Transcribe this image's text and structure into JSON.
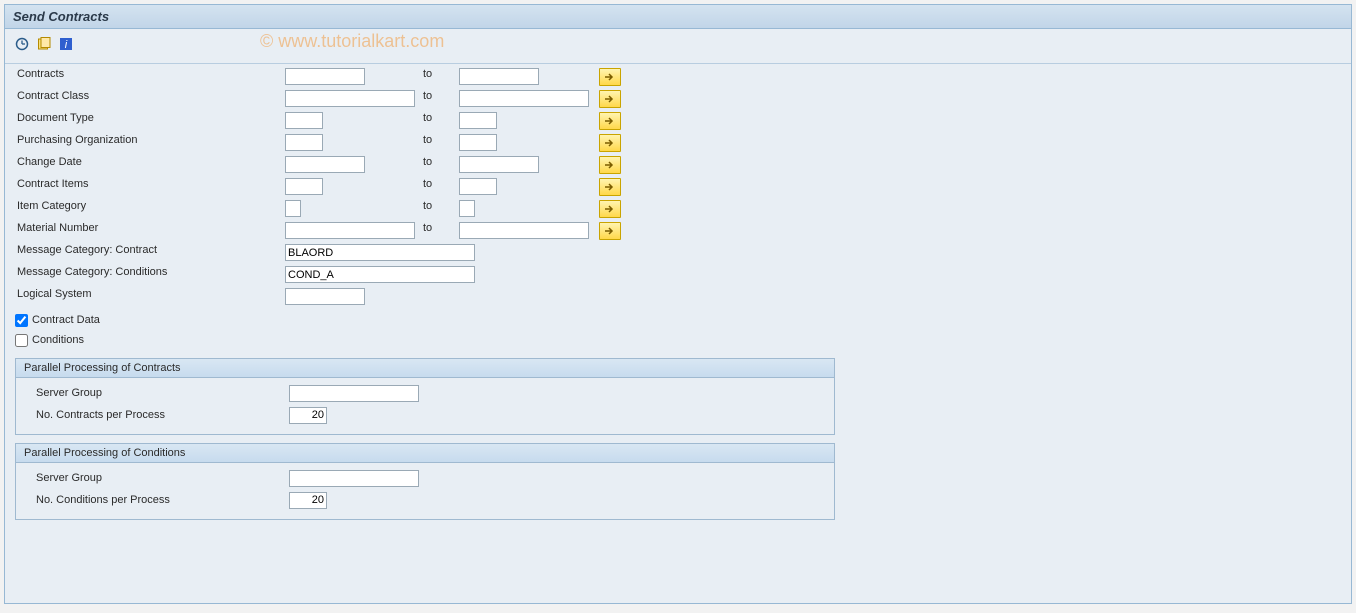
{
  "window": {
    "title": "Send Contracts"
  },
  "watermark": "© www.tutorialkart.com",
  "toolbar": {
    "execute": "execute",
    "variant": "get-variant",
    "info": "info"
  },
  "fields": {
    "contracts": {
      "label": "Contracts",
      "low": "",
      "to": "to",
      "high": ""
    },
    "contract_class": {
      "label": "Contract Class",
      "low": "",
      "to": "to",
      "high": ""
    },
    "document_type": {
      "label": "Document Type",
      "low": "",
      "to": "to",
      "high": ""
    },
    "purchasing_org": {
      "label": "Purchasing Organization",
      "low": "",
      "to": "to",
      "high": ""
    },
    "change_date": {
      "label": "Change Date",
      "low": "",
      "to": "to",
      "high": ""
    },
    "contract_items": {
      "label": "Contract Items",
      "low": "",
      "to": "to",
      "high": ""
    },
    "item_category": {
      "label": "Item Category",
      "low": "",
      "to": "to",
      "high": ""
    },
    "material_number": {
      "label": "Material Number",
      "low": "",
      "to": "to",
      "high": ""
    },
    "msg_cat_contract": {
      "label": "Message Category: Contract",
      "value": "BLAORD"
    },
    "msg_cat_conditions": {
      "label": "Message Category: Conditions",
      "value": "COND_A"
    },
    "logical_system": {
      "label": "Logical System",
      "value": ""
    },
    "contract_data_cb": {
      "label": "Contract Data",
      "checked": true
    },
    "conditions_cb": {
      "label": "Conditions",
      "checked": false
    }
  },
  "group1": {
    "title": "Parallel Processing of Contracts",
    "server_group_label": "Server Group",
    "server_group_value": "",
    "count_label": "No. Contracts per Process",
    "count_value": "20"
  },
  "group2": {
    "title": "Parallel Processing of Conditions",
    "server_group_label": "Server Group",
    "server_group_value": "",
    "count_label": "No. Conditions per Process",
    "count_value": "20"
  }
}
